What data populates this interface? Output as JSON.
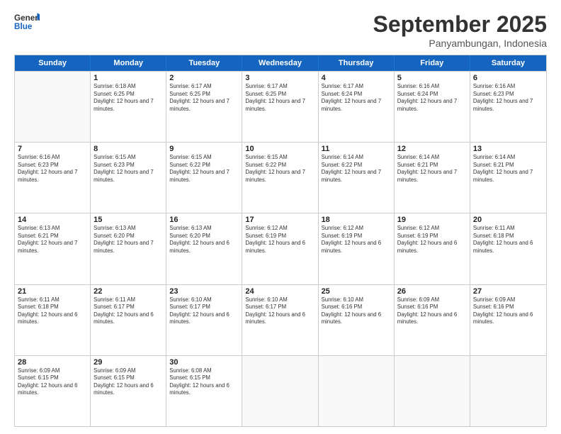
{
  "header": {
    "logo_general": "General",
    "logo_blue": "Blue",
    "month": "September 2025",
    "location": "Panyambungan, Indonesia"
  },
  "days_of_week": [
    "Sunday",
    "Monday",
    "Tuesday",
    "Wednesday",
    "Thursday",
    "Friday",
    "Saturday"
  ],
  "weeks": [
    [
      {
        "day": "",
        "sunrise": "",
        "sunset": "",
        "daylight": ""
      },
      {
        "day": "1",
        "sunrise": "Sunrise: 6:18 AM",
        "sunset": "Sunset: 6:25 PM",
        "daylight": "Daylight: 12 hours and 7 minutes."
      },
      {
        "day": "2",
        "sunrise": "Sunrise: 6:17 AM",
        "sunset": "Sunset: 6:25 PM",
        "daylight": "Daylight: 12 hours and 7 minutes."
      },
      {
        "day": "3",
        "sunrise": "Sunrise: 6:17 AM",
        "sunset": "Sunset: 6:25 PM",
        "daylight": "Daylight: 12 hours and 7 minutes."
      },
      {
        "day": "4",
        "sunrise": "Sunrise: 6:17 AM",
        "sunset": "Sunset: 6:24 PM",
        "daylight": "Daylight: 12 hours and 7 minutes."
      },
      {
        "day": "5",
        "sunrise": "Sunrise: 6:16 AM",
        "sunset": "Sunset: 6:24 PM",
        "daylight": "Daylight: 12 hours and 7 minutes."
      },
      {
        "day": "6",
        "sunrise": "Sunrise: 6:16 AM",
        "sunset": "Sunset: 6:23 PM",
        "daylight": "Daylight: 12 hours and 7 minutes."
      }
    ],
    [
      {
        "day": "7",
        "sunrise": "Sunrise: 6:16 AM",
        "sunset": "Sunset: 6:23 PM",
        "daylight": "Daylight: 12 hours and 7 minutes."
      },
      {
        "day": "8",
        "sunrise": "Sunrise: 6:15 AM",
        "sunset": "Sunset: 6:23 PM",
        "daylight": "Daylight: 12 hours and 7 minutes."
      },
      {
        "day": "9",
        "sunrise": "Sunrise: 6:15 AM",
        "sunset": "Sunset: 6:22 PM",
        "daylight": "Daylight: 12 hours and 7 minutes."
      },
      {
        "day": "10",
        "sunrise": "Sunrise: 6:15 AM",
        "sunset": "Sunset: 6:22 PM",
        "daylight": "Daylight: 12 hours and 7 minutes."
      },
      {
        "day": "11",
        "sunrise": "Sunrise: 6:14 AM",
        "sunset": "Sunset: 6:22 PM",
        "daylight": "Daylight: 12 hours and 7 minutes."
      },
      {
        "day": "12",
        "sunrise": "Sunrise: 6:14 AM",
        "sunset": "Sunset: 6:21 PM",
        "daylight": "Daylight: 12 hours and 7 minutes."
      },
      {
        "day": "13",
        "sunrise": "Sunrise: 6:14 AM",
        "sunset": "Sunset: 6:21 PM",
        "daylight": "Daylight: 12 hours and 7 minutes."
      }
    ],
    [
      {
        "day": "14",
        "sunrise": "Sunrise: 6:13 AM",
        "sunset": "Sunset: 6:21 PM",
        "daylight": "Daylight: 12 hours and 7 minutes."
      },
      {
        "day": "15",
        "sunrise": "Sunrise: 6:13 AM",
        "sunset": "Sunset: 6:20 PM",
        "daylight": "Daylight: 12 hours and 7 minutes."
      },
      {
        "day": "16",
        "sunrise": "Sunrise: 6:13 AM",
        "sunset": "Sunset: 6:20 PM",
        "daylight": "Daylight: 12 hours and 6 minutes."
      },
      {
        "day": "17",
        "sunrise": "Sunrise: 6:12 AM",
        "sunset": "Sunset: 6:19 PM",
        "daylight": "Daylight: 12 hours and 6 minutes."
      },
      {
        "day": "18",
        "sunrise": "Sunrise: 6:12 AM",
        "sunset": "Sunset: 6:19 PM",
        "daylight": "Daylight: 12 hours and 6 minutes."
      },
      {
        "day": "19",
        "sunrise": "Sunrise: 6:12 AM",
        "sunset": "Sunset: 6:19 PM",
        "daylight": "Daylight: 12 hours and 6 minutes."
      },
      {
        "day": "20",
        "sunrise": "Sunrise: 6:11 AM",
        "sunset": "Sunset: 6:18 PM",
        "daylight": "Daylight: 12 hours and 6 minutes."
      }
    ],
    [
      {
        "day": "21",
        "sunrise": "Sunrise: 6:11 AM",
        "sunset": "Sunset: 6:18 PM",
        "daylight": "Daylight: 12 hours and 6 minutes."
      },
      {
        "day": "22",
        "sunrise": "Sunrise: 6:11 AM",
        "sunset": "Sunset: 6:17 PM",
        "daylight": "Daylight: 12 hours and 6 minutes."
      },
      {
        "day": "23",
        "sunrise": "Sunrise: 6:10 AM",
        "sunset": "Sunset: 6:17 PM",
        "daylight": "Daylight: 12 hours and 6 minutes."
      },
      {
        "day": "24",
        "sunrise": "Sunrise: 6:10 AM",
        "sunset": "Sunset: 6:17 PM",
        "daylight": "Daylight: 12 hours and 6 minutes."
      },
      {
        "day": "25",
        "sunrise": "Sunrise: 6:10 AM",
        "sunset": "Sunset: 6:16 PM",
        "daylight": "Daylight: 12 hours and 6 minutes."
      },
      {
        "day": "26",
        "sunrise": "Sunrise: 6:09 AM",
        "sunset": "Sunset: 6:16 PM",
        "daylight": "Daylight: 12 hours and 6 minutes."
      },
      {
        "day": "27",
        "sunrise": "Sunrise: 6:09 AM",
        "sunset": "Sunset: 6:16 PM",
        "daylight": "Daylight: 12 hours and 6 minutes."
      }
    ],
    [
      {
        "day": "28",
        "sunrise": "Sunrise: 6:09 AM",
        "sunset": "Sunset: 6:15 PM",
        "daylight": "Daylight: 12 hours and 6 minutes."
      },
      {
        "day": "29",
        "sunrise": "Sunrise: 6:09 AM",
        "sunset": "Sunset: 6:15 PM",
        "daylight": "Daylight: 12 hours and 6 minutes."
      },
      {
        "day": "30",
        "sunrise": "Sunrise: 6:08 AM",
        "sunset": "Sunset: 6:15 PM",
        "daylight": "Daylight: 12 hours and 6 minutes."
      },
      {
        "day": "",
        "sunrise": "",
        "sunset": "",
        "daylight": ""
      },
      {
        "day": "",
        "sunrise": "",
        "sunset": "",
        "daylight": ""
      },
      {
        "day": "",
        "sunrise": "",
        "sunset": "",
        "daylight": ""
      },
      {
        "day": "",
        "sunrise": "",
        "sunset": "",
        "daylight": ""
      }
    ]
  ]
}
